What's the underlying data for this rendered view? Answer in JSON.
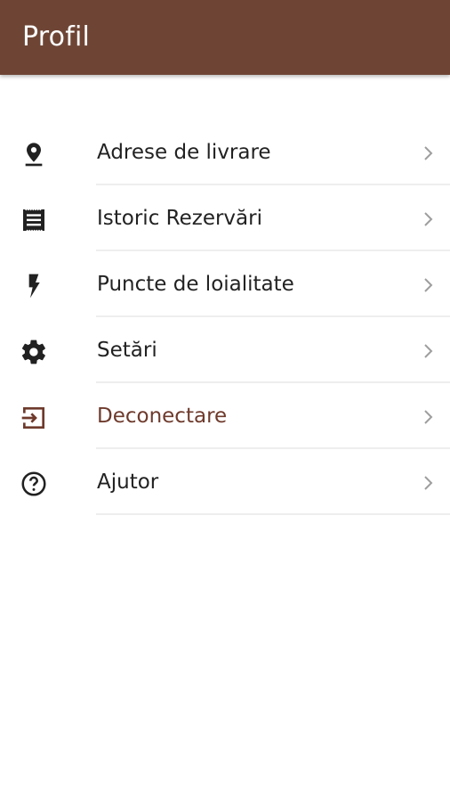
{
  "header": {
    "title": "Profil",
    "color": "#6e4535"
  },
  "menu": {
    "items": [
      {
        "label": "Adrese de livrare",
        "icon": "location-pin-icon"
      },
      {
        "label": "Istoric Rezervări",
        "icon": "receipt-icon"
      },
      {
        "label": "Puncte de loialitate",
        "icon": "lightning-icon"
      },
      {
        "label": "Setări",
        "icon": "gear-icon"
      },
      {
        "label": "Deconectare",
        "icon": "logout-icon",
        "color": "#6e3a2c"
      },
      {
        "label": "Ajutor",
        "icon": "help-circle-icon"
      }
    ]
  }
}
